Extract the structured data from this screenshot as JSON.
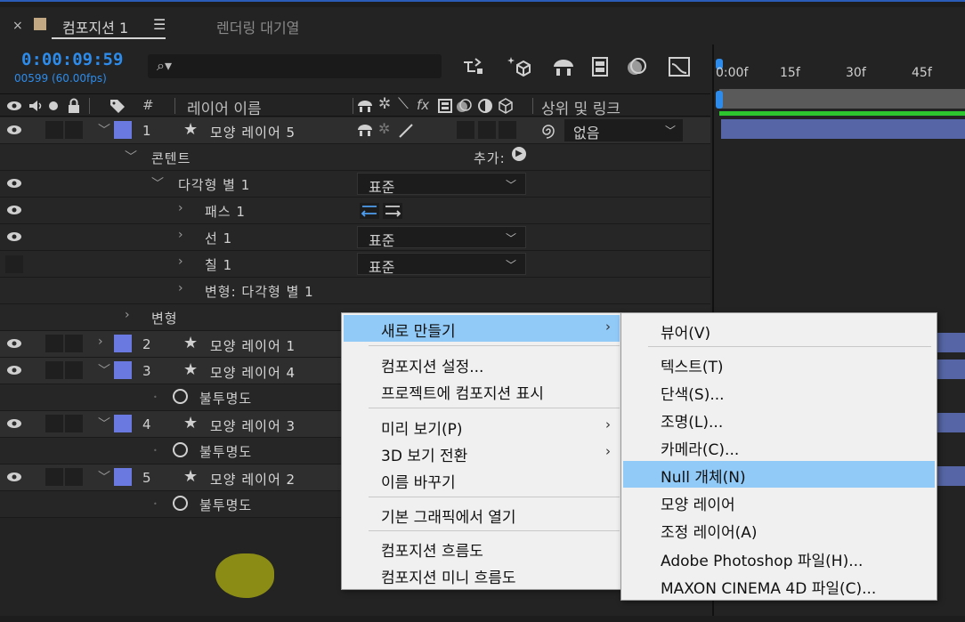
{
  "window": {
    "close_glyph": "×",
    "comp_tab": "컴포지션 1",
    "menu_glyph": "☰",
    "render_queue_tab": "렌더링 대기열"
  },
  "toolbar": {
    "timecode": "0:00:09:59",
    "framecode": "00599 (60.00fps)",
    "search_glyph": "⌕▾"
  },
  "columns": {
    "layer_name": "레이어 이름",
    "hash": "#",
    "parent_link": "상위 및 링크",
    "fx": "fx"
  },
  "layers": {
    "l1": {
      "num": "1",
      "name": "모양 레이어 5",
      "parent": "없음"
    },
    "l1_content": "콘텐트",
    "l1_add": "추가:",
    "polystar": "다각형 별 1",
    "polystar_mode": "표준",
    "path": "패스 1",
    "stroke": "선 1",
    "stroke_mode": "표준",
    "fill": "칠 1",
    "fill_mode": "표준",
    "poly_transform": "변형: 다각형 별 1",
    "transform": "변형",
    "l2": {
      "num": "2",
      "name": "모양 레이어 1"
    },
    "l3": {
      "num": "3",
      "name": "모양 레이어 4"
    },
    "opacity1": "불투명도",
    "l4": {
      "num": "4",
      "name": "모양 레이어 3"
    },
    "opacity2": "불투명도",
    "l5": {
      "num": "5",
      "name": "모양 레이어 2"
    },
    "opacity3": "불투명도"
  },
  "timeline": {
    "ticks": [
      "0:00f",
      "15f",
      "30f",
      "45f"
    ]
  },
  "context_menu": {
    "new": "새로 만들기",
    "comp_settings": "컴포지션 설정...",
    "reveal_in_project": "프로젝트에 컴포지션 표시",
    "preview": "미리 보기(P)",
    "switch_3d_view": "3D 보기 전환",
    "rename": "이름 바꾸기",
    "open_in_essential_graphics": "기본 그래픽에서 열기",
    "comp_flowchart": "컴포지션 흐름도",
    "comp_mini_flowchart": "컴포지션 미니 흐름도"
  },
  "submenu": {
    "viewer": "뷰어(V)",
    "text": "텍스트(T)",
    "solid": "단색(S)...",
    "light": "조명(L)...",
    "camera": "카메라(C)...",
    "null_object": "Null 개체(N)",
    "shape_layer": "모양 레이어",
    "adjustment_layer": "조정 레이어(A)",
    "photoshop_file": "Adobe Photoshop 파일(H)...",
    "cinema4d_file": "MAXON CINEMA 4D 파일(C)..."
  },
  "colors": {
    "accent_blue": "#2d8ceb",
    "label_blue": "#6a79df",
    "menu_highlight": "#91c9f7",
    "work_area_green": "#2ec62e"
  }
}
